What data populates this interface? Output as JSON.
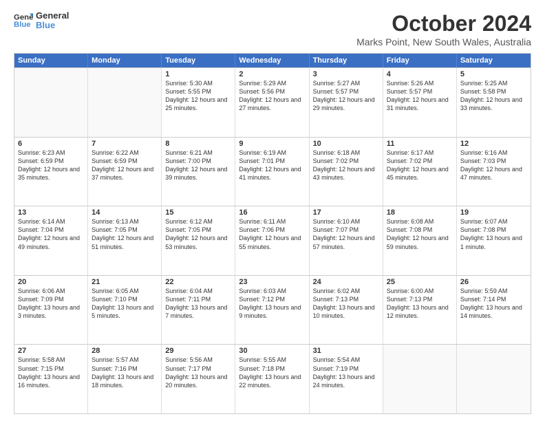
{
  "logo": {
    "line1": "General",
    "line2": "Blue"
  },
  "title": "October 2024",
  "subtitle": "Marks Point, New South Wales, Australia",
  "header_days": [
    "Sunday",
    "Monday",
    "Tuesday",
    "Wednesday",
    "Thursday",
    "Friday",
    "Saturday"
  ],
  "weeks": [
    [
      {
        "day": "",
        "sunrise": "",
        "sunset": "",
        "daylight": ""
      },
      {
        "day": "",
        "sunrise": "",
        "sunset": "",
        "daylight": ""
      },
      {
        "day": "1",
        "sunrise": "Sunrise: 5:30 AM",
        "sunset": "Sunset: 5:55 PM",
        "daylight": "Daylight: 12 hours and 25 minutes."
      },
      {
        "day": "2",
        "sunrise": "Sunrise: 5:29 AM",
        "sunset": "Sunset: 5:56 PM",
        "daylight": "Daylight: 12 hours and 27 minutes."
      },
      {
        "day": "3",
        "sunrise": "Sunrise: 5:27 AM",
        "sunset": "Sunset: 5:57 PM",
        "daylight": "Daylight: 12 hours and 29 minutes."
      },
      {
        "day": "4",
        "sunrise": "Sunrise: 5:26 AM",
        "sunset": "Sunset: 5:57 PM",
        "daylight": "Daylight: 12 hours and 31 minutes."
      },
      {
        "day": "5",
        "sunrise": "Sunrise: 5:25 AM",
        "sunset": "Sunset: 5:58 PM",
        "daylight": "Daylight: 12 hours and 33 minutes."
      }
    ],
    [
      {
        "day": "6",
        "sunrise": "Sunrise: 6:23 AM",
        "sunset": "Sunset: 6:59 PM",
        "daylight": "Daylight: 12 hours and 35 minutes."
      },
      {
        "day": "7",
        "sunrise": "Sunrise: 6:22 AM",
        "sunset": "Sunset: 6:59 PM",
        "daylight": "Daylight: 12 hours and 37 minutes."
      },
      {
        "day": "8",
        "sunrise": "Sunrise: 6:21 AM",
        "sunset": "Sunset: 7:00 PM",
        "daylight": "Daylight: 12 hours and 39 minutes."
      },
      {
        "day": "9",
        "sunrise": "Sunrise: 6:19 AM",
        "sunset": "Sunset: 7:01 PM",
        "daylight": "Daylight: 12 hours and 41 minutes."
      },
      {
        "day": "10",
        "sunrise": "Sunrise: 6:18 AM",
        "sunset": "Sunset: 7:02 PM",
        "daylight": "Daylight: 12 hours and 43 minutes."
      },
      {
        "day": "11",
        "sunrise": "Sunrise: 6:17 AM",
        "sunset": "Sunset: 7:02 PM",
        "daylight": "Daylight: 12 hours and 45 minutes."
      },
      {
        "day": "12",
        "sunrise": "Sunrise: 6:16 AM",
        "sunset": "Sunset: 7:03 PM",
        "daylight": "Daylight: 12 hours and 47 minutes."
      }
    ],
    [
      {
        "day": "13",
        "sunrise": "Sunrise: 6:14 AM",
        "sunset": "Sunset: 7:04 PM",
        "daylight": "Daylight: 12 hours and 49 minutes."
      },
      {
        "day": "14",
        "sunrise": "Sunrise: 6:13 AM",
        "sunset": "Sunset: 7:05 PM",
        "daylight": "Daylight: 12 hours and 51 minutes."
      },
      {
        "day": "15",
        "sunrise": "Sunrise: 6:12 AM",
        "sunset": "Sunset: 7:05 PM",
        "daylight": "Daylight: 12 hours and 53 minutes."
      },
      {
        "day": "16",
        "sunrise": "Sunrise: 6:11 AM",
        "sunset": "Sunset: 7:06 PM",
        "daylight": "Daylight: 12 hours and 55 minutes."
      },
      {
        "day": "17",
        "sunrise": "Sunrise: 6:10 AM",
        "sunset": "Sunset: 7:07 PM",
        "daylight": "Daylight: 12 hours and 57 minutes."
      },
      {
        "day": "18",
        "sunrise": "Sunrise: 6:08 AM",
        "sunset": "Sunset: 7:08 PM",
        "daylight": "Daylight: 12 hours and 59 minutes."
      },
      {
        "day": "19",
        "sunrise": "Sunrise: 6:07 AM",
        "sunset": "Sunset: 7:08 PM",
        "daylight": "Daylight: 13 hours and 1 minute."
      }
    ],
    [
      {
        "day": "20",
        "sunrise": "Sunrise: 6:06 AM",
        "sunset": "Sunset: 7:09 PM",
        "daylight": "Daylight: 13 hours and 3 minutes."
      },
      {
        "day": "21",
        "sunrise": "Sunrise: 6:05 AM",
        "sunset": "Sunset: 7:10 PM",
        "daylight": "Daylight: 13 hours and 5 minutes."
      },
      {
        "day": "22",
        "sunrise": "Sunrise: 6:04 AM",
        "sunset": "Sunset: 7:11 PM",
        "daylight": "Daylight: 13 hours and 7 minutes."
      },
      {
        "day": "23",
        "sunrise": "Sunrise: 6:03 AM",
        "sunset": "Sunset: 7:12 PM",
        "daylight": "Daylight: 13 hours and 9 minutes."
      },
      {
        "day": "24",
        "sunrise": "Sunrise: 6:02 AM",
        "sunset": "Sunset: 7:13 PM",
        "daylight": "Daylight: 13 hours and 10 minutes."
      },
      {
        "day": "25",
        "sunrise": "Sunrise: 6:00 AM",
        "sunset": "Sunset: 7:13 PM",
        "daylight": "Daylight: 13 hours and 12 minutes."
      },
      {
        "day": "26",
        "sunrise": "Sunrise: 5:59 AM",
        "sunset": "Sunset: 7:14 PM",
        "daylight": "Daylight: 13 hours and 14 minutes."
      }
    ],
    [
      {
        "day": "27",
        "sunrise": "Sunrise: 5:58 AM",
        "sunset": "Sunset: 7:15 PM",
        "daylight": "Daylight: 13 hours and 16 minutes."
      },
      {
        "day": "28",
        "sunrise": "Sunrise: 5:57 AM",
        "sunset": "Sunset: 7:16 PM",
        "daylight": "Daylight: 13 hours and 18 minutes."
      },
      {
        "day": "29",
        "sunrise": "Sunrise: 5:56 AM",
        "sunset": "Sunset: 7:17 PM",
        "daylight": "Daylight: 13 hours and 20 minutes."
      },
      {
        "day": "30",
        "sunrise": "Sunrise: 5:55 AM",
        "sunset": "Sunset: 7:18 PM",
        "daylight": "Daylight: 13 hours and 22 minutes."
      },
      {
        "day": "31",
        "sunrise": "Sunrise: 5:54 AM",
        "sunset": "Sunset: 7:19 PM",
        "daylight": "Daylight: 13 hours and 24 minutes."
      },
      {
        "day": "",
        "sunrise": "",
        "sunset": "",
        "daylight": ""
      },
      {
        "day": "",
        "sunrise": "",
        "sunset": "",
        "daylight": ""
      }
    ]
  ]
}
